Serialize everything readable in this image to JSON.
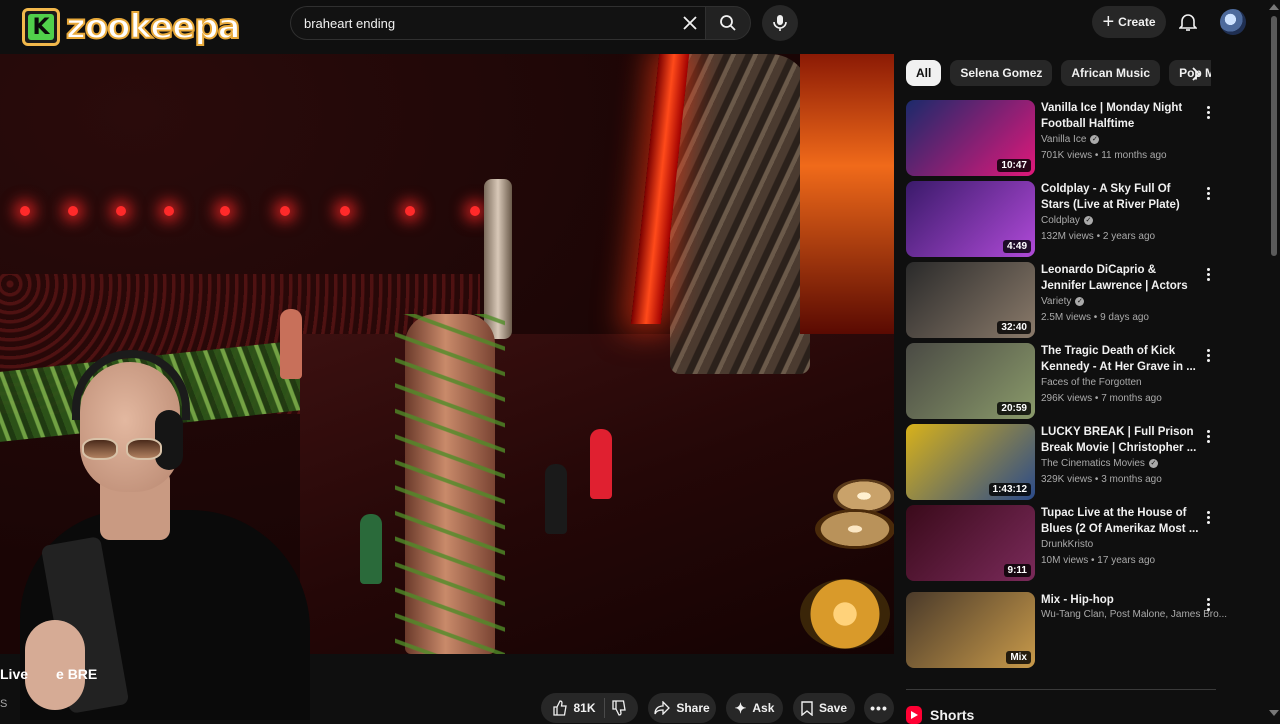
{
  "logo": {
    "badge": "K",
    "text": "zookeepa"
  },
  "search": {
    "value": "braheart ending"
  },
  "header": {
    "create_label": "Create"
  },
  "video": {
    "title_fragment": "Live",
    "title_fragment2": "e BRE",
    "channel_fragment": "S"
  },
  "actions": {
    "like_count": "81K",
    "share_label": "Share",
    "ask_label": "Ask",
    "save_label": "Save"
  },
  "chips": [
    "All",
    "Selena Gomez",
    "African Music",
    "Pop Mu"
  ],
  "recommendations": [
    {
      "title": "Vanilla Ice | Monday Night Football Halftime Performanc...",
      "channel": "Vanilla Ice",
      "verified": true,
      "views": "701K views • 11 months ago",
      "duration": "10:47",
      "thumb_colors": [
        "#1b2a6b",
        "#e0187a"
      ]
    },
    {
      "title": "Coldplay - A Sky Full Of Stars (Live at River Plate)",
      "channel": "Coldplay",
      "verified": true,
      "views": "132M views • 2 years ago",
      "duration": "4:49",
      "thumb_colors": [
        "#3a1a6a",
        "#b04ad8"
      ]
    },
    {
      "title": "Leonardo DiCaprio & Jennifer Lawrence | Actors on Actors",
      "channel": "Variety",
      "verified": true,
      "views": "2.5M views • 9 days ago",
      "duration": "32:40",
      "thumb_colors": [
        "#2a2a2a",
        "#8a7a6a"
      ]
    },
    {
      "title": "The Tragic Death of Kick Kennedy - At Her Grave in ...",
      "channel": "Faces of the Forgotten",
      "verified": false,
      "views": "296K views • 7 months ago",
      "duration": "20:59",
      "thumb_colors": [
        "#4a4a44",
        "#8a9a6a"
      ]
    },
    {
      "title": "LUCKY BREAK | Full Prison Break Movie | Christopher ...",
      "channel": "The Cinematics Movies",
      "verified": true,
      "views": "329K views • 3 months ago",
      "duration": "1:43:12",
      "thumb_colors": [
        "#d8b21a",
        "#2a4a8a"
      ]
    },
    {
      "title": "Tupac Live at the House of Blues (2 Of Amerikaz Most ...",
      "channel": "DrunkKristo",
      "verified": false,
      "views": "10M views • 17 years ago",
      "duration": "9:11",
      "thumb_colors": [
        "#3a0a1a",
        "#7a2a5a"
      ]
    },
    {
      "title": "Mix - Hip-hop",
      "channel": "Wu-Tang Clan, Post Malone, James Bro...",
      "verified": false,
      "views": "",
      "duration": "Mix",
      "thumb_colors": [
        "#4a3a2a",
        "#c89a4a"
      ]
    }
  ],
  "shorts": {
    "label": "Shorts"
  },
  "colors": {
    "background": "#0f0f0f",
    "accent_red": "#ff0033",
    "chip_bg": "#272727"
  }
}
